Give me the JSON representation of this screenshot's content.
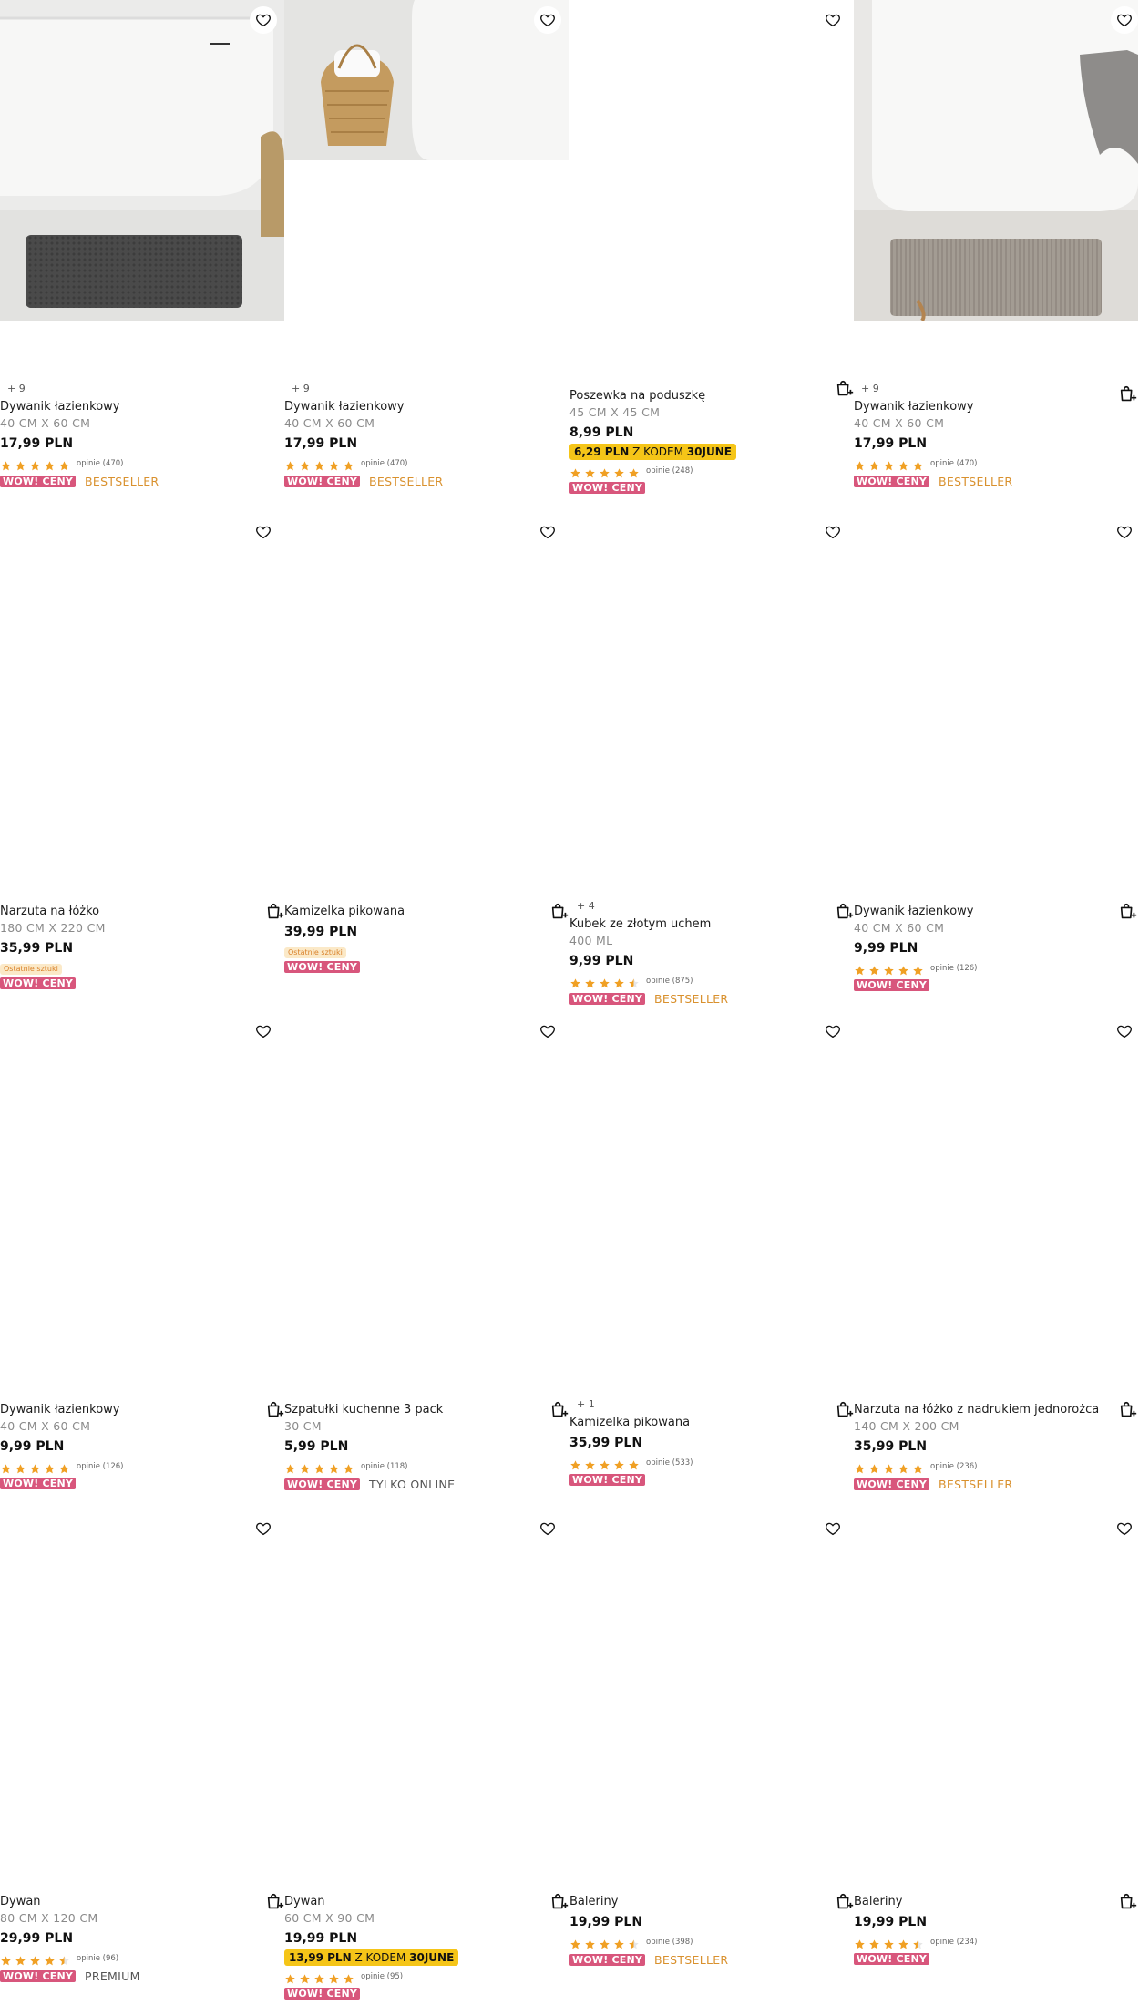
{
  "icons": {
    "favorite": "heart-outline-icon",
    "cart": "add-to-cart-icon",
    "star": "star-icon"
  },
  "colors": {
    "wow_badge": "#d8567c",
    "bestseller": "#d9912e",
    "promo_bg": "#f5c518",
    "star": "#f0a024"
  },
  "products": [
    {
      "variants": "+ 9",
      "title": "Dywanik łazienkowy",
      "size": "40 CM X 60 CM",
      "price": "17,99 PLN",
      "stars": 5,
      "reviews": "opinie (470)",
      "badge": "WOW! CENY",
      "tag": "BESTSELLER",
      "tag_type": "best"
    },
    {
      "variants": "+ 9",
      "title": "Dywanik łazienkowy",
      "size": "40 CM X 60 CM",
      "price": "17,99 PLN",
      "stars": 5,
      "reviews": "opinie (470)",
      "badge": "WOW! CENY",
      "tag": "BESTSELLER",
      "tag_type": "best"
    },
    {
      "title": "Poszewka na poduszkę",
      "size": "45 CM X 45 CM",
      "price": "8,99 PLN",
      "promo_price": "6,29 PLN",
      "promo_mid": " Z KODEM ",
      "promo_code": "30JUNE",
      "stars": 5,
      "reviews": "opinie (248)",
      "badge": "WOW! CENY"
    },
    {
      "variants": "+ 9",
      "title": "Dywanik łazienkowy",
      "size": "40 CM X 60 CM",
      "price": "17,99 PLN",
      "stars": 5,
      "reviews": "opinie (470)",
      "badge": "WOW! CENY",
      "tag": "BESTSELLER",
      "tag_type": "best"
    },
    {
      "title": "Narzuta na łóżko",
      "size": "180 CM X 220 CM",
      "price": "35,99 PLN",
      "last": "Ostatnie sztuki",
      "badge": "WOW! CENY"
    },
    {
      "title": "Kamizelka pikowana",
      "price": "39,99 PLN",
      "last": "Ostatnie sztuki",
      "badge": "WOW! CENY"
    },
    {
      "variants": "+ 4",
      "title": "Kubek ze złotym uchem",
      "size": "400 ML",
      "price": "9,99 PLN",
      "stars": 4.5,
      "reviews": "opinie (875)",
      "badge": "WOW! CENY",
      "tag": "BESTSELLER",
      "tag_type": "best"
    },
    {
      "title": "Dywanik łazienkowy",
      "size": "40 CM X 60 CM",
      "price": "9,99 PLN",
      "stars": 5,
      "reviews": "opinie (126)",
      "badge": "WOW! CENY"
    },
    {
      "title": "Dywanik łazienkowy",
      "size": "40 CM X 60 CM",
      "price": "9,99 PLN",
      "stars": 5,
      "reviews": "opinie (126)",
      "badge": "WOW! CENY"
    },
    {
      "title": "Szpatułki kuchenne 3 pack",
      "size": "30 CM",
      "price": "5,99 PLN",
      "stars": 5,
      "reviews": "opinie (118)",
      "badge": "WOW! CENY",
      "tag": "TYLKO ONLINE",
      "tag_type": "grey"
    },
    {
      "variants": "+ 1",
      "title": "Kamizelka pikowana",
      "price": "35,99 PLN",
      "stars": 5,
      "reviews": "opinie (533)",
      "badge": "WOW! CENY"
    },
    {
      "title": "Narzuta na łóżko z nadrukiem jednorożca",
      "size": "140 CM X 200 CM",
      "price": "35,99 PLN",
      "stars": 5,
      "reviews": "opinie (236)",
      "badge": "WOW! CENY",
      "tag": "BESTSELLER",
      "tag_type": "best"
    },
    {
      "title": "Dywan",
      "size": "80 CM X 120 CM",
      "price": "29,99 PLN",
      "stars": 4.5,
      "reviews": "opinie (96)",
      "badge": "WOW! CENY",
      "tag": "PREMIUM",
      "tag_type": "grey"
    },
    {
      "title": "Dywan",
      "size": "60 CM X 90 CM",
      "price": "19,99 PLN",
      "promo_price": "13,99 PLN",
      "promo_mid": " Z KODEM ",
      "promo_code": "30JUNE",
      "stars": 5,
      "reviews": "opinie (95)",
      "badge": "WOW! CENY"
    },
    {
      "title": "Baleriny",
      "price": "19,99 PLN",
      "stars": 4.5,
      "reviews": "opinie (398)",
      "badge": "WOW! CENY",
      "tag": "BESTSELLER",
      "tag_type": "best"
    },
    {
      "title": "Baleriny",
      "price": "19,99 PLN",
      "stars": 4.5,
      "reviews": "opinie (234)",
      "badge": "WOW! CENY"
    }
  ]
}
